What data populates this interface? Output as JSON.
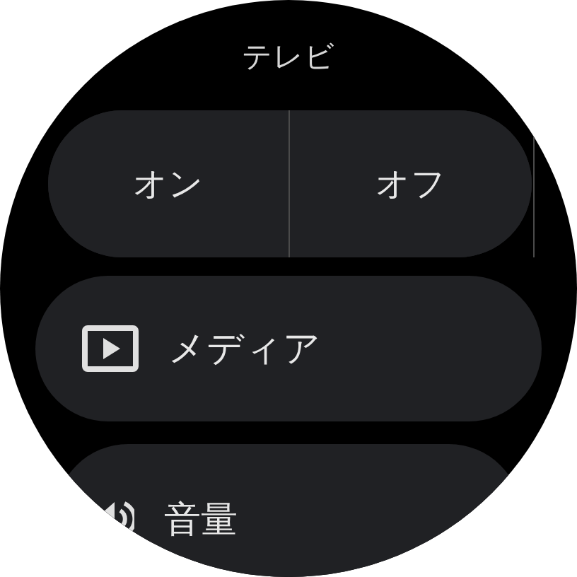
{
  "title": "テレビ",
  "toggle_buttons": [
    {
      "label": "オン"
    },
    {
      "label": "オフ"
    }
  ],
  "chips": [
    {
      "kind": "media",
      "label": "メディア"
    },
    {
      "kind": "volume",
      "label": "音量"
    }
  ]
}
